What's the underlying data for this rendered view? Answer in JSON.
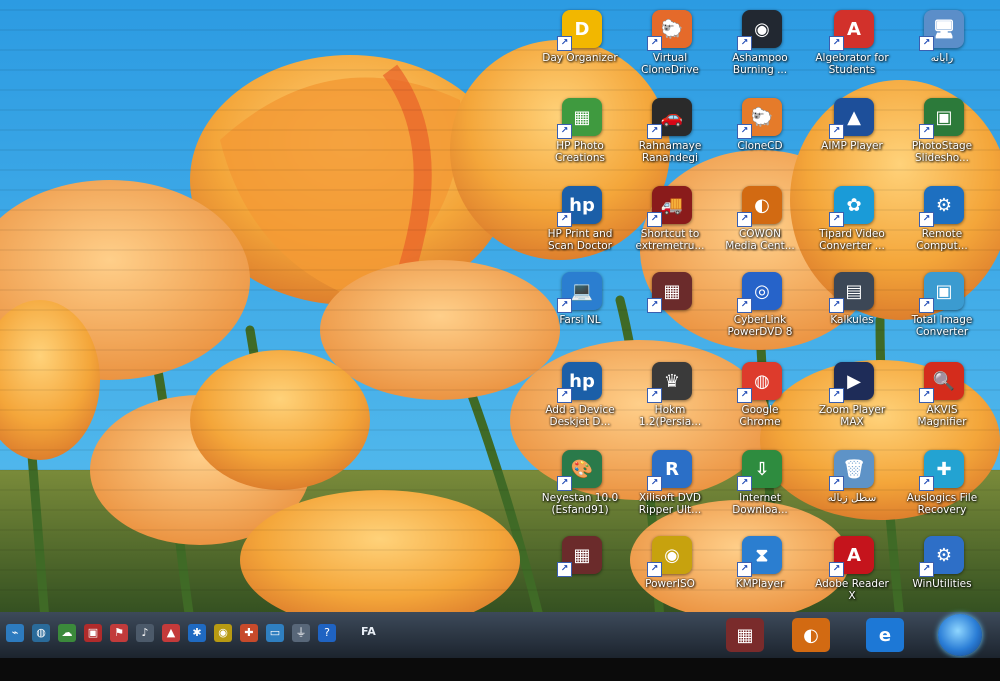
{
  "desktop": {
    "icons": [
      {
        "name": "day-organizer-icon",
        "label": "Day Organizer",
        "color": "#f2b700",
        "glyph": "D"
      },
      {
        "name": "virtual-clonedrive-icon",
        "label": "Virtual\nCloneDrive",
        "color": "#e56a2a",
        "glyph": "🐑"
      },
      {
        "name": "ashampoo-burning-icon",
        "label": "Ashampoo\nBurning ...",
        "color": "#222831",
        "glyph": "◉"
      },
      {
        "name": "algebrator-icon",
        "label": "Algebrator for\nStudents",
        "color": "#d2312b",
        "glyph": "A"
      },
      {
        "name": "computer-icon",
        "label": "رایانه",
        "color": "#5b8ec9",
        "glyph": "🖥"
      },
      {
        "name": "hp-photo-creations-icon",
        "label": "HP Photo\nCreations",
        "color": "#3f9a3f",
        "glyph": "▦"
      },
      {
        "name": "rahnamaye-ranandegi-icon",
        "label": "Rahnamaye\nRanandegi",
        "color": "#2a2a2a",
        "glyph": "🚗"
      },
      {
        "name": "clonecd-icon",
        "label": "CloneCD",
        "color": "#e57b2a",
        "glyph": "🐑"
      },
      {
        "name": "aimp-player-icon",
        "label": "AIMP Player",
        "color": "#1d4f9a",
        "glyph": "▲"
      },
      {
        "name": "photostage-icon",
        "label": "PhotoStage\nSlidesho...",
        "color": "#2c7a3a",
        "glyph": "▣"
      },
      {
        "name": "hp-print-scan-doctor-icon",
        "label": "HP Print and\nScan Doctor",
        "color": "#1b5fa8",
        "glyph": "hp"
      },
      {
        "name": "extreme-truck-icon",
        "label": "Shortcut to\nextremetru...",
        "color": "#8a1b1b",
        "glyph": "🚚"
      },
      {
        "name": "cowon-media-center-icon",
        "label": "COWON\nMedia Cent...",
        "color": "#d26a12",
        "glyph": "◐"
      },
      {
        "name": "tipard-video-converter-icon",
        "label": "Tipard Video\nConverter ...",
        "color": "#1a9bd8",
        "glyph": "✿"
      },
      {
        "name": "remote-computer-icon",
        "label": "Remote\nComput...",
        "color": "#1d6fc0",
        "glyph": "⚙"
      },
      {
        "name": "farsi-nl-icon",
        "label": "Farsi NL",
        "color": "#2b7ed0",
        "glyph": "💻"
      },
      {
        "name": "sudoku-icon",
        "label": "",
        "color": "#6b2b2b",
        "glyph": "▦"
      },
      {
        "name": "cyberlink-powerdvd-icon",
        "label": "CyberLink\nPowerDVD 8",
        "color": "#2663c9",
        "glyph": "◎"
      },
      {
        "name": "kalkules-icon",
        "label": "Kalkules",
        "color": "#3c4756",
        "glyph": "▤"
      },
      {
        "name": "total-image-converter-icon",
        "label": "Total Image\nConverter",
        "color": "#3b9bd0",
        "glyph": "▣"
      },
      {
        "name": "add-a-device-icon",
        "label": "Add a Device\nDeskjet D...",
        "color": "#1b5fa8",
        "glyph": "hp"
      },
      {
        "name": "hokm-icon",
        "label": "Hokm\n1.2(Persia...",
        "color": "#3a3a3a",
        "glyph": "♛"
      },
      {
        "name": "google-chrome-icon",
        "label": "Google\nChrome",
        "color": "#dd3b2c",
        "glyph": "◍"
      },
      {
        "name": "zoom-player-icon",
        "label": "Zoom Player\nMAX",
        "color": "#1e2c58",
        "glyph": "▶"
      },
      {
        "name": "akvis-magnifier-icon",
        "label": "AKVIS\nMagnifier",
        "color": "#d42c1c",
        "glyph": "🔍"
      },
      {
        "name": "neyestan-icon",
        "label": "Neyestan 10.0\n(Esfand91)",
        "color": "#2a7a4a",
        "glyph": "🎨"
      },
      {
        "name": "xilisoft-dvd-ripper-icon",
        "label": "Xilisoft DVD\nRipper Ult...",
        "color": "#2b6fc7",
        "glyph": "R"
      },
      {
        "name": "internet-download-manager-icon",
        "label": "Internet\nDownloa...",
        "color": "#2e8c3f",
        "glyph": "⇩"
      },
      {
        "name": "recycle-bin-icon",
        "label": "سطل زباله",
        "color": "#5e93c7",
        "glyph": "🗑"
      },
      {
        "name": "auslogics-file-recovery-icon",
        "label": "Auslogics File\nRecovery",
        "color": "#23a3d2",
        "glyph": "✚"
      },
      {
        "name": "sudoku-2-icon",
        "label": "",
        "color": "#6b2b2b",
        "glyph": "▦"
      },
      {
        "name": "poweriso-icon",
        "label": "PowerISO",
        "color": "#c7a20e",
        "glyph": "◉"
      },
      {
        "name": "kmplayer-icon",
        "label": "KMPlayer",
        "color": "#2b7ed0",
        "glyph": "⧗"
      },
      {
        "name": "adobe-reader-icon",
        "label": "Adobe Reader\nX",
        "color": "#c5141c",
        "glyph": "A"
      },
      {
        "name": "winutilities-icon",
        "label": "WinUtilities",
        "color": "#2e6fc7",
        "glyph": "⚙"
      }
    ]
  },
  "taskbar": {
    "tray_icons": [
      {
        "name": "network-icon",
        "color": "#2d7bbf",
        "glyph": "⌁"
      },
      {
        "name": "antivirus-icon",
        "color": "#2a6b9a",
        "glyph": "◍"
      },
      {
        "name": "cloud-sync-icon",
        "color": "#3b8a3b",
        "glyph": "☁"
      },
      {
        "name": "display-icon",
        "color": "#b02b2b",
        "glyph": "▣"
      },
      {
        "name": "flag-icon",
        "color": "#c23b3b",
        "glyph": "⚑"
      },
      {
        "name": "volume-icon",
        "color": "#4c5a6a",
        "glyph": "♪"
      },
      {
        "name": "power-manager-icon",
        "color": "#c43a3a",
        "glyph": "▲"
      },
      {
        "name": "bluetooth-icon",
        "color": "#1f6ac2",
        "glyph": "✱"
      },
      {
        "name": "disc-tray-icon",
        "color": "#b89a12",
        "glyph": "◉"
      },
      {
        "name": "updates-icon",
        "color": "#c74a2b",
        "glyph": "✚"
      },
      {
        "name": "monitor-tray-icon",
        "color": "#2f7fc0",
        "glyph": "▭"
      },
      {
        "name": "usb-icon",
        "color": "#586779",
        "glyph": "⏚"
      },
      {
        "name": "help-icon",
        "color": "#1f63c2",
        "glyph": "?"
      }
    ],
    "language": "FA",
    "pinned": [
      {
        "name": "sudoku-taskbar-icon",
        "color": "#7a2b2b",
        "glyph": "▦"
      },
      {
        "name": "cowon-taskbar-icon",
        "color": "#d26a12",
        "glyph": "◐"
      },
      {
        "name": "internet-explorer-icon",
        "color": "#1d78d6",
        "glyph": "e"
      }
    ]
  }
}
